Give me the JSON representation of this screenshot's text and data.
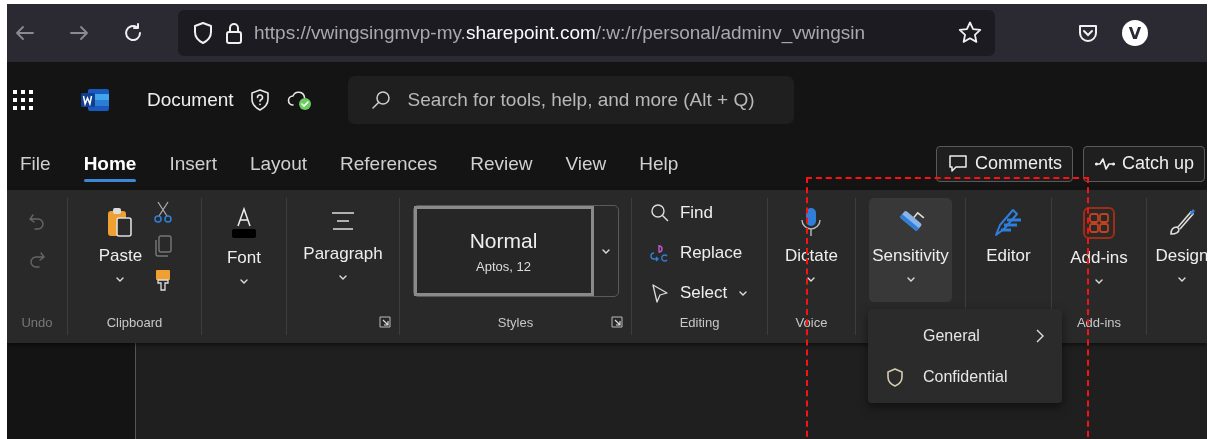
{
  "browser": {
    "url": {
      "scheme_host": "https://vwingsingmvp-my.",
      "domain": "sharepoint.com",
      "path": "/:w:/r/personal/adminv_vwingsin"
    },
    "profile_initial": "V"
  },
  "app": {
    "title": "Document",
    "search": {
      "placeholder": "Search for tools, help, and more (Alt + Q)"
    }
  },
  "tabs": [
    {
      "label": "File",
      "selected": false
    },
    {
      "label": "Home",
      "selected": true
    },
    {
      "label": "Insert",
      "selected": false
    },
    {
      "label": "Layout",
      "selected": false
    },
    {
      "label": "References",
      "selected": false
    },
    {
      "label": "Review",
      "selected": false
    },
    {
      "label": "View",
      "selected": false
    },
    {
      "label": "Help",
      "selected": false
    }
  ],
  "header_buttons": [
    {
      "kind": "comments",
      "label": "Comments"
    },
    {
      "kind": "catchup",
      "label": "Catch up"
    }
  ],
  "ribbon": {
    "groups": [
      {
        "kind": "undo",
        "label": "Undo"
      },
      {
        "kind": "clipboard",
        "label": "Clipboard",
        "button": "Paste"
      },
      {
        "kind": "big",
        "button": "Font"
      },
      {
        "kind": "big",
        "button": "Paragraph"
      },
      {
        "kind": "styles",
        "label": "Styles",
        "style_name": "Normal",
        "style_font": "Aptos, 12"
      },
      {
        "kind": "editing",
        "label": "Editing",
        "items": [
          {
            "label": "Find"
          },
          {
            "label": "Replace"
          },
          {
            "label": "Select"
          }
        ]
      },
      {
        "kind": "big",
        "button": "Dictate",
        "label": "Voice"
      },
      {
        "kind": "big",
        "button": "Sensitivity",
        "selected": true
      },
      {
        "kind": "big",
        "button": "Editor"
      },
      {
        "kind": "big",
        "button": "Add-ins",
        "label": "Add-ins"
      },
      {
        "kind": "big",
        "button": "Design"
      }
    ]
  },
  "menu": {
    "items": [
      {
        "kind": "submenu",
        "label": "General"
      },
      {
        "kind": "label",
        "label": "Confidential"
      }
    ]
  },
  "highlight_frame": {
    "shown": true
  }
}
